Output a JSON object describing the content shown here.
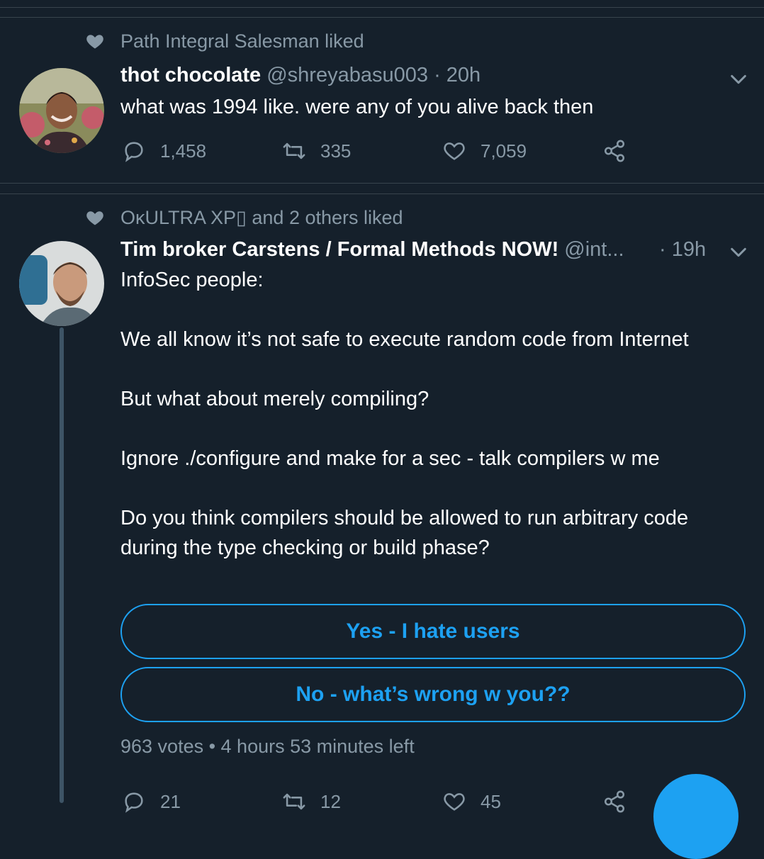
{
  "tweets": [
    {
      "liked_by": "Path Integral Salesman liked",
      "name": "thot chocolate",
      "handle": "@shreyabasu003",
      "time": "· 20h",
      "text": "what was 1994 like. were any of you alive back then",
      "stats": {
        "replies": "1,458",
        "retweets": "335",
        "likes": "7,059"
      }
    },
    {
      "liked_by": "OκULTRA XP▯ and 2 others liked",
      "name": "Tim broker Carstens / Formal Methods NOW!",
      "handle": "@int...",
      "time": "· 19h",
      "paragraphs": [
        "InfoSec people:",
        "We all know it’s not safe to execute random code from Internet",
        "But what about merely compiling?",
        "Ignore ./configure and make for a sec - talk compilers w me",
        "Do you think compilers should be allowed to run arbitrary code during the type checking or build phase?"
      ],
      "poll": {
        "options": [
          "Yes - I hate users",
          "No - what’s wrong w you??"
        ],
        "meta": "963 votes • 4 hours 53 minutes left"
      },
      "stats": {
        "replies": "21",
        "retweets": "12",
        "likes": "45"
      }
    }
  ],
  "icons": [
    "heart-icon",
    "chevron-down-icon",
    "reply-icon",
    "retweet-icon",
    "like-icon",
    "share-icon"
  ],
  "colors": {
    "background": "#15202b",
    "accent": "#1da1f2",
    "muted": "#8899a6",
    "divider": "#38444d"
  }
}
